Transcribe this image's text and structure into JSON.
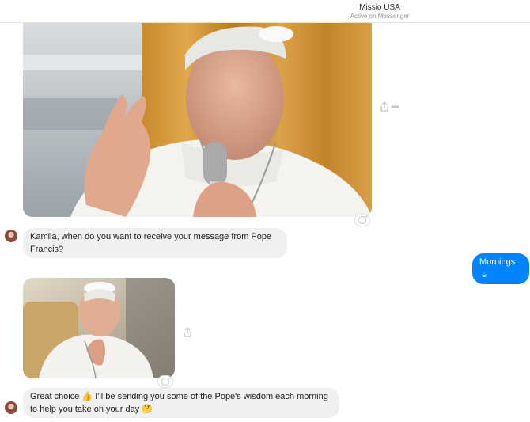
{
  "header": {
    "title": "Missio USA",
    "status": "Active on Messenger"
  },
  "messages": [
    {
      "sender": "bot",
      "text": "Kamila, when do you want to receive your message from Pope Francis?"
    },
    {
      "sender": "user",
      "text": "Mornings",
      "emoji": "☕"
    },
    {
      "sender": "bot",
      "text_part1": "Great choice ",
      "emoji1": "👍",
      "text_part2": " I'll be sending you some of the Pope's wisdom each morning to help you take on your day ",
      "emoji2": "🤔"
    }
  ],
  "icons": {
    "share": "share-icon",
    "more": "more-options-icon",
    "react": "reaction-icon",
    "more_glyph": "•••"
  },
  "colors": {
    "bubble_out": "#0084ff",
    "bubble_in": "#f1f0f0"
  }
}
